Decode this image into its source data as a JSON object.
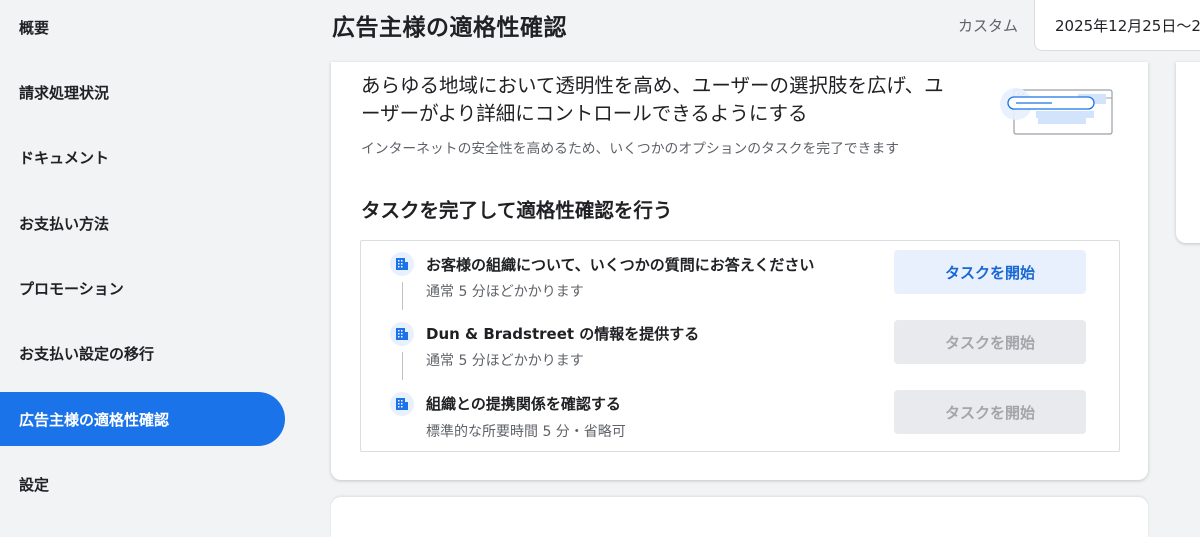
{
  "sidebar": {
    "items": [
      {
        "label": "概要"
      },
      {
        "label": "請求処理状況"
      },
      {
        "label": "ドキュメント"
      },
      {
        "label": "お支払い方法"
      },
      {
        "label": "プロモーション"
      },
      {
        "label": "お支払い設定の移行"
      },
      {
        "label": "広告主様の適格性確認",
        "active": true
      },
      {
        "label": "設定"
      }
    ]
  },
  "header": {
    "title": "広告主様の適格性確認",
    "range_label": "カスタム",
    "date_range": "2025年12月25日～2"
  },
  "card": {
    "headline": "あらゆる地域において透明性を高め、ユーザーの選択肢を広げ、ユーザーがより詳細にコントロールできるようにする",
    "subtext": "インターネットの安全性を高めるため、いくつかのオプションのタスクを完了できます",
    "section_title": "タスクを完了して適格性確認を行う",
    "tasks": [
      {
        "title": "お客様の組織について、いくつかの質問にお答えください",
        "subtitle": "通常 5 分ほどかかります",
        "button": "タスクを開始",
        "enabled": true,
        "icon": "building-icon"
      },
      {
        "title": "Dun & Bradstreet の情報を提供する",
        "subtitle": "通常 5 分ほどかかります",
        "button": "タスクを開始",
        "enabled": false,
        "icon": "building-icon"
      },
      {
        "title": "組織との提携関係を確認する",
        "subtitle": "標準的な所要時間 5 分・省略可",
        "button": "タスクを開始",
        "enabled": false,
        "icon": "building-icon"
      }
    ]
  },
  "colors": {
    "accent": "#1a73e8",
    "button_enabled_bg": "#e8f0fe",
    "button_enabled_text": "#1967d2",
    "button_disabled_bg": "#e8eaed",
    "button_disabled_text": "#a2a6ab"
  }
}
